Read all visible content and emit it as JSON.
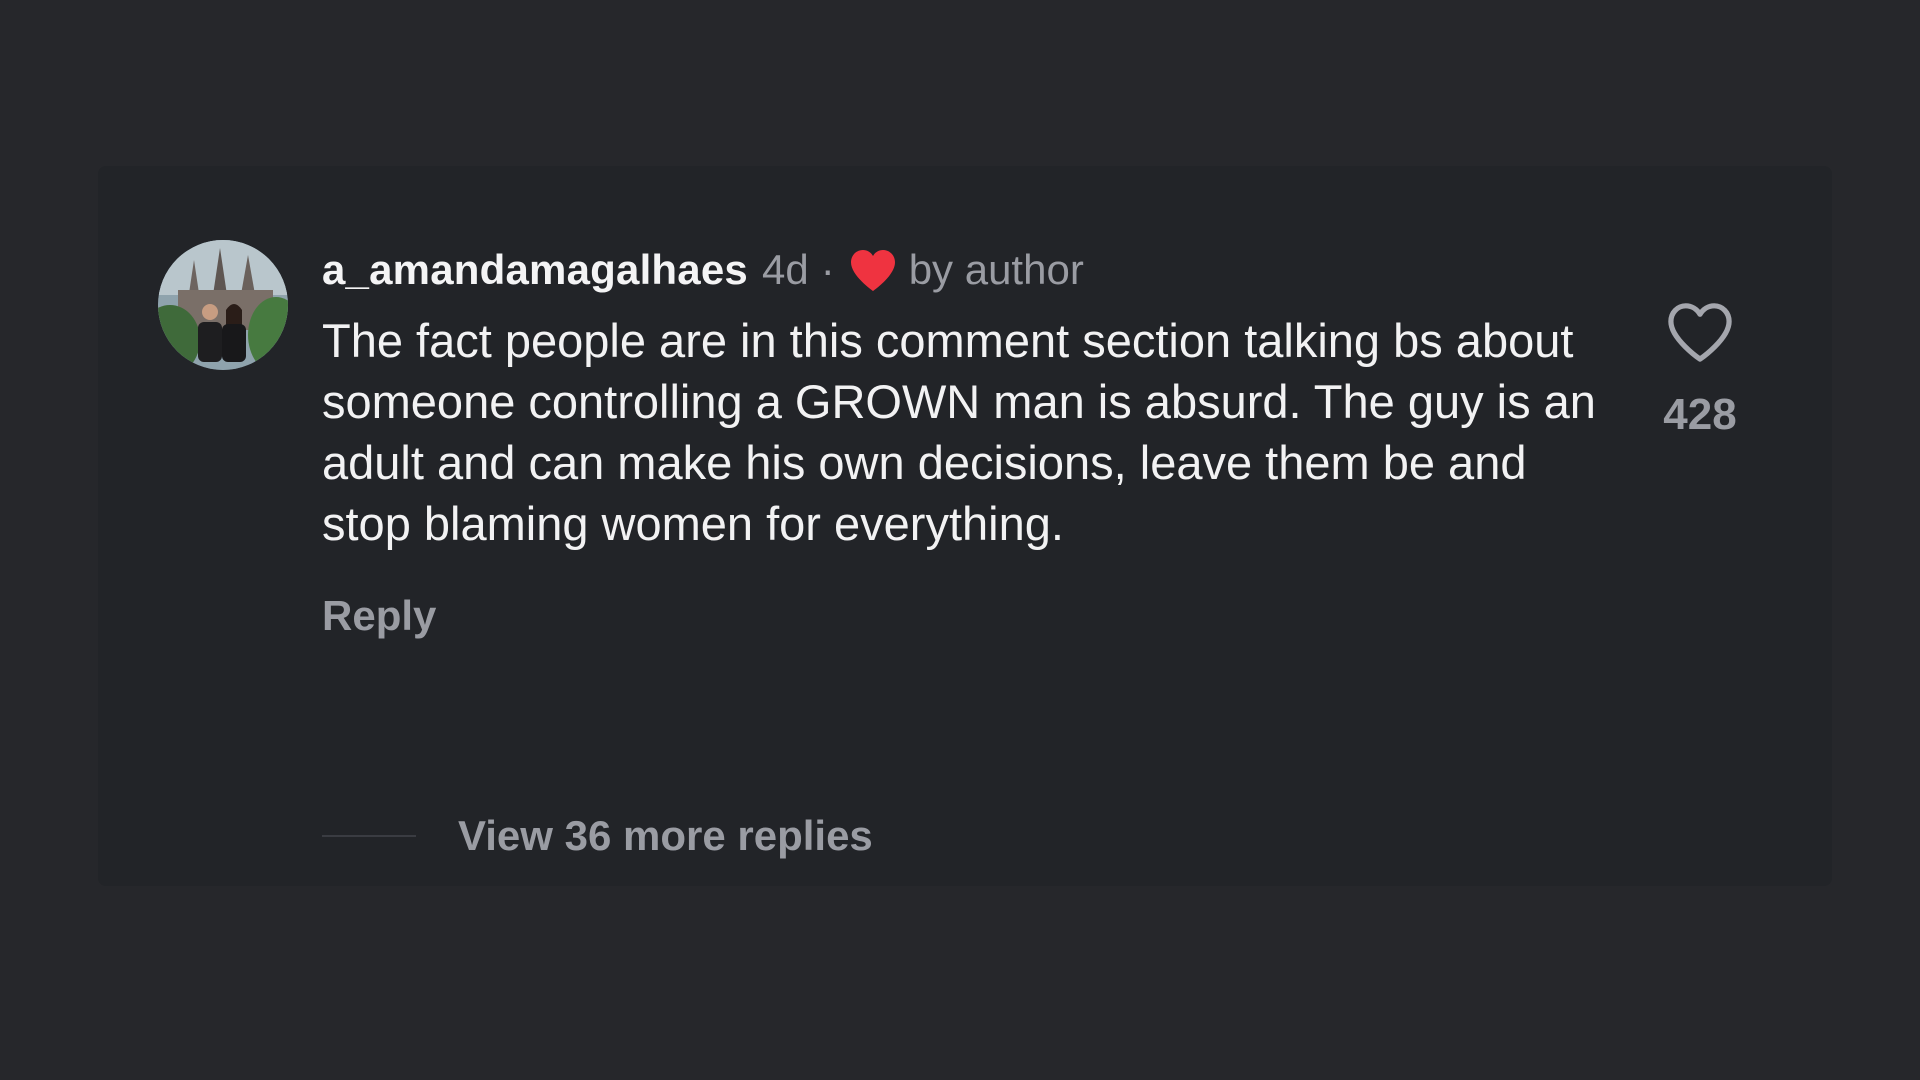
{
  "comment": {
    "username": "a_amandamagalhaes",
    "time": "4d",
    "separator": "·",
    "author_like_label": "by author",
    "text": "The fact people are in this comment section talking bs about someone controlling a GROWN man is absurd. The guy is an adult and can make his own decisions, leave them be and stop blaming women for everything.",
    "reply_label": "Reply",
    "view_replies_label": "View 36 more replies",
    "like_count": "428"
  },
  "icons": {
    "author_heart": "heart-filled-icon",
    "like": "heart-outline-icon"
  },
  "colors": {
    "background": "#26272b",
    "card": "#222428",
    "username": "#f4f4f5",
    "text": "#f2f2f3",
    "muted": "#9a9ca3",
    "heart_red": "#ef3340"
  }
}
